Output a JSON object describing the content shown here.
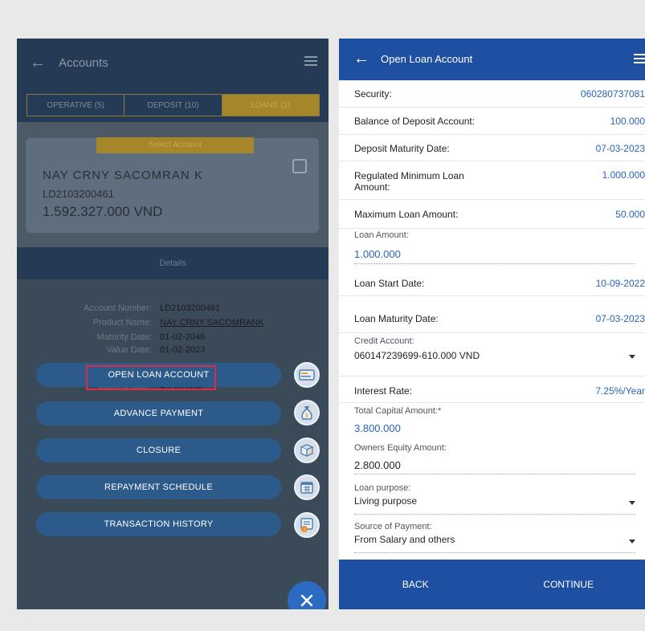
{
  "left_screen": {
    "app_bar": {
      "title": "Accounts"
    },
    "tabs": [
      "OPERATIVE (5)",
      "DEPOSIT (10)",
      "LOANS (3)"
    ],
    "account_card": {
      "select_label": "Select Account",
      "name": "NAY CRNY SACOMRAN K",
      "account_number": "LD2103200461",
      "balance": "1.592.327.000 VND"
    },
    "details_label": "Details",
    "details": [
      {
        "label": "Account Number:",
        "value": "LD2103200461"
      },
      {
        "label": "Product Name:",
        "value": "NAY CRNY SACOMRANK"
      },
      {
        "label": "Maturity Date:",
        "value": "01-02-2046"
      },
      {
        "label": "Value Date:",
        "value": "01-02-2023"
      },
      {
        "label": "Interest Rate:",
        "value": "4.1% /Year"
      }
    ],
    "actions": [
      "OPEN LOAN ACCOUNT",
      "ADVANCE PAYMENT",
      "CLOSURE",
      "REPAYMENT SCHEDULE",
      "TRANSACTION HISTORY"
    ],
    "action_icons": [
      "loan-card-icon",
      "money-bag-icon",
      "box-icon",
      "calendar-icon",
      "history-icon"
    ],
    "fab_icon": "close-icon"
  },
  "right_screen": {
    "app_bar": {
      "title": "Open Loan Account"
    },
    "rows": [
      {
        "label": "Security:",
        "value": "060280737081"
      },
      {
        "label": "Balance of Deposit Account:",
        "value": "100.000"
      },
      {
        "label": "Deposit Maturity Date:",
        "value": "07-03-2023"
      },
      {
        "label": "Regulated Minimum Loan Amount:",
        "value": "1.000.000"
      },
      {
        "label": "Maximum Loan Amount:",
        "value": "50.000"
      }
    ],
    "loan_amount": {
      "label": "Loan Amount:",
      "value": "1.000.000"
    },
    "loan_start": {
      "label": "Loan Start Date:",
      "value": "10-09-2022"
    },
    "loan_maturity": {
      "label": "Loan Maturity Date:",
      "value": "07-03-2023"
    },
    "credit_account": {
      "label": "Credit Account:",
      "value": "060147239699-610.000 VND"
    },
    "interest_rate": {
      "label": "Interest Rate:",
      "value": "7.25%/Year"
    },
    "total_capital": {
      "label": "Total Capital Amount:*",
      "value": "3.800.000"
    },
    "owners_equity": {
      "label": "Owners Equity Amount:",
      "value": "2.800.000"
    },
    "loan_purpose": {
      "label": "Loan purpose:",
      "value": "Living purpose"
    },
    "source_payment": {
      "label": "Source of Payment:",
      "value": "From Salary and others"
    },
    "buttons": {
      "back": "BACK",
      "continue": "CONTINUE"
    }
  },
  "colors": {
    "primary": "#1f4fa0",
    "value_blue": "#2863b8",
    "highlight": "#e02b45",
    "gold": "#a6862a"
  }
}
